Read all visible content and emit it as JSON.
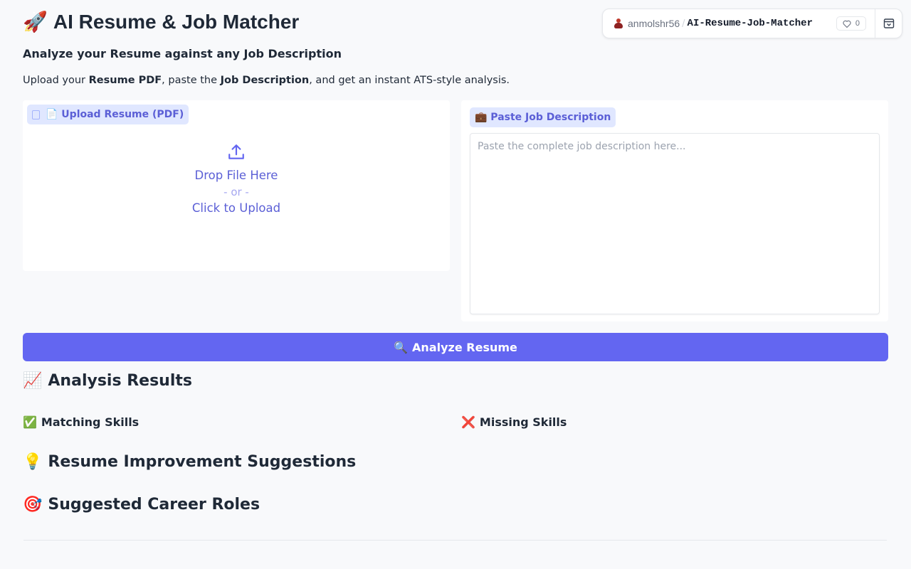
{
  "space_badge": {
    "user": "anmolshr56",
    "separator": "/",
    "repo": "AI-Resume-Job-Matcher",
    "likes": "0"
  },
  "header": {
    "title_emoji": "🚀",
    "title": "AI Resume & Job Matcher",
    "subtitle": "Analyze your Resume against any Job Description",
    "intro": {
      "part1": "Upload your ",
      "bold1": "Resume PDF",
      "part2": ", paste the ",
      "bold2": "Job Description",
      "part3": ", and get an instant ATS-style analysis."
    }
  },
  "upload": {
    "label": "📄 Upload Resume (PDF)",
    "drop_text": "Drop File Here",
    "or_text": "- or -",
    "click_text": "Click to Upload"
  },
  "job_description": {
    "label": "💼 Paste Job Description",
    "placeholder": "Paste the complete job description here...",
    "value": ""
  },
  "analyze_button": {
    "emoji": "🔍",
    "label": "Analyze Resume"
  },
  "results": {
    "title_emoji": "📈",
    "title": "Analysis Results",
    "matching_emoji": "✅",
    "matching": "Matching Skills",
    "missing_emoji": "❌",
    "missing": "Missing Skills",
    "suggestions_emoji": "💡",
    "suggestions": "Resume Improvement Suggestions",
    "careers_emoji": "🎯",
    "careers": "Suggested Career Roles"
  },
  "colors": {
    "accent": "#6366f1",
    "chip_bg": "#e0e7ff",
    "page_bg": "#f8f9fb"
  }
}
